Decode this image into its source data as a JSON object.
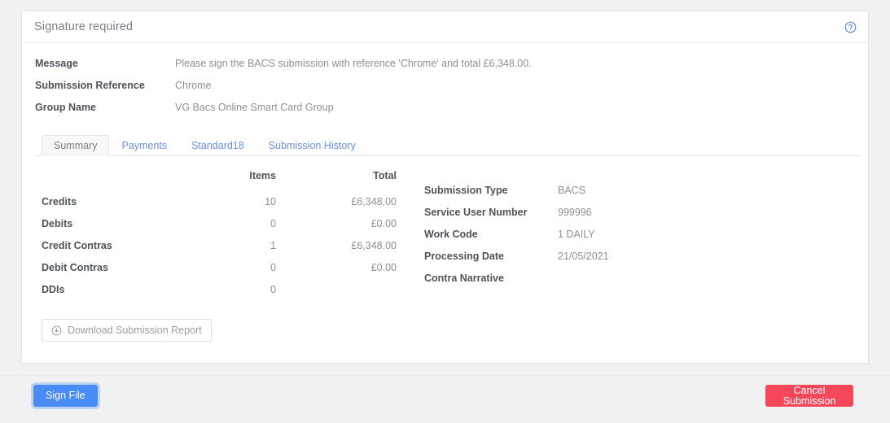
{
  "card": {
    "title": "Signature required",
    "help_icon": "help-circle-icon"
  },
  "info": [
    {
      "label": "Message",
      "value": "Please sign the BACS submission with reference 'Chrome' and total £6,348.00."
    },
    {
      "label": "Submission Reference",
      "value": "Chrome"
    },
    {
      "label": "Group Name",
      "value": "VG Bacs Online Smart Card Group"
    }
  ],
  "tabs": [
    {
      "label": "Summary",
      "active": true
    },
    {
      "label": "Payments",
      "active": false
    },
    {
      "label": "Standard18",
      "active": false
    },
    {
      "label": "Submission History",
      "active": false
    }
  ],
  "totals_table": {
    "headers": {
      "blank": "",
      "items": "Items",
      "total": "Total"
    },
    "rows": [
      {
        "label": "Credits",
        "items": "10",
        "total": "£6,348.00"
      },
      {
        "label": "Debits",
        "items": "0",
        "total": "£0.00"
      },
      {
        "label": "Credit Contras",
        "items": "1",
        "total": "£6,348.00"
      },
      {
        "label": "Debit Contras",
        "items": "0",
        "total": "£0.00"
      },
      {
        "label": "DDIs",
        "items": "0",
        "total": ""
      }
    ]
  },
  "details": [
    {
      "label": "Submission Type",
      "value": "BACS"
    },
    {
      "label": "Service User Number",
      "value": "999996"
    },
    {
      "label": "Work Code",
      "value": "1 DAILY"
    },
    {
      "label": "Processing Date",
      "value": "21/05/2021"
    },
    {
      "label": "Contra Narrative",
      "value": ""
    }
  ],
  "download_button": {
    "label": "Download Submission Report",
    "icon": "download-circle-icon"
  },
  "footer": {
    "sign_label": "Sign File",
    "cancel_label": "Cancel Submission"
  },
  "colors": {
    "primary": "#4a8cf7",
    "danger": "#f4485a",
    "link": "#6b8fe0",
    "page_background": "#f1f1f1"
  }
}
